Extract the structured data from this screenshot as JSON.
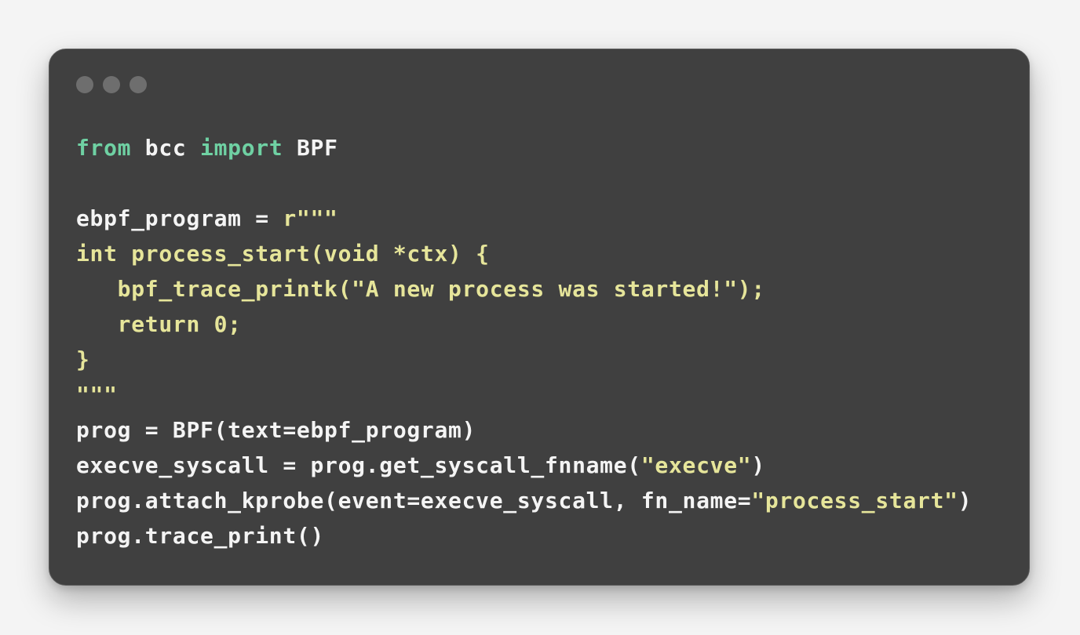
{
  "window_controls": {
    "color": "#6e6e6e",
    "dots": [
      "close",
      "minimize",
      "maximize"
    ]
  },
  "colors": {
    "keyword": "#6fd1a3",
    "plain": "#f4f4f4",
    "string": "#e6e59a",
    "background": "#404040"
  },
  "code": {
    "lines": [
      [
        {
          "t": "from",
          "c": "kw"
        },
        {
          "t": " bcc ",
          "c": "plain"
        },
        {
          "t": "import",
          "c": "kw"
        },
        {
          "t": " BPF",
          "c": "plain"
        }
      ],
      [],
      [
        {
          "t": "ebpf_program = ",
          "c": "plain"
        },
        {
          "t": "r\"\"\"",
          "c": "str"
        }
      ],
      [
        {
          "t": "int process_start(void *ctx) {",
          "c": "str"
        }
      ],
      [
        {
          "t": "   bpf_trace_printk(\"A new process was started!\");",
          "c": "str"
        }
      ],
      [
        {
          "t": "   return 0;",
          "c": "str"
        }
      ],
      [
        {
          "t": "}",
          "c": "str"
        }
      ],
      [
        {
          "t": "\"\"\"",
          "c": "str"
        }
      ],
      [
        {
          "t": "prog = BPF(text=ebpf_program)",
          "c": "plain"
        }
      ],
      [
        {
          "t": "execve_syscall = prog.get_syscall_fnname(",
          "c": "plain"
        },
        {
          "t": "\"execve\"",
          "c": "str"
        },
        {
          "t": ")",
          "c": "plain"
        }
      ],
      [
        {
          "t": "prog.attach_kprobe(event=execve_syscall, fn_name=",
          "c": "plain"
        },
        {
          "t": "\"process_start\"",
          "c": "str"
        },
        {
          "t": ")",
          "c": "plain"
        }
      ],
      [
        {
          "t": "prog.trace_print()",
          "c": "plain"
        }
      ]
    ]
  }
}
